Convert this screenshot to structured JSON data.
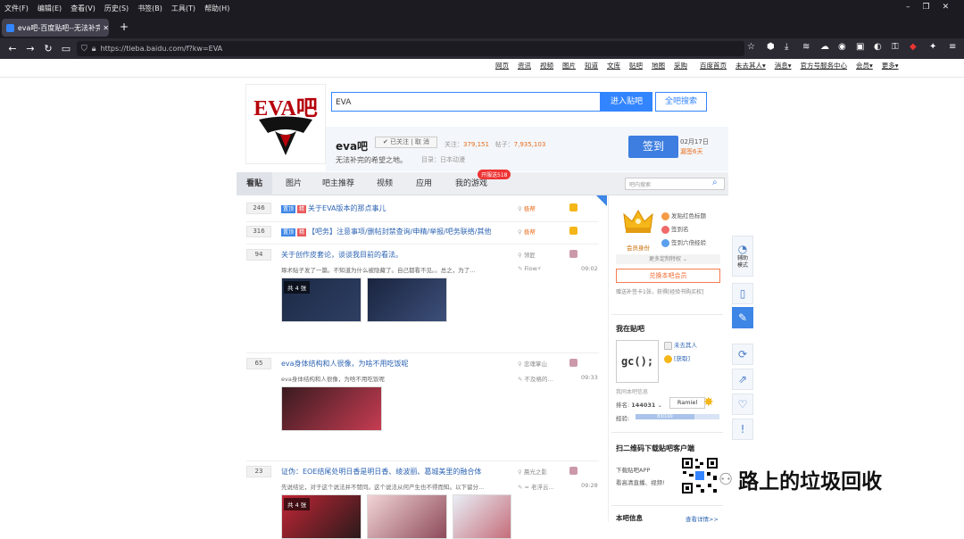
{
  "menubar": [
    "文件(F)",
    "编辑(E)",
    "查看(V)",
    "历史(S)",
    "书签(B)",
    "工具(T)",
    "帮助(H)"
  ],
  "window_controls": [
    "–",
    "❐",
    "✕"
  ],
  "tab": {
    "title": "eva吧-百度贴吧--无法补完",
    "close": "✕",
    "new": "+"
  },
  "url": "https://tieba.baidu.com/f?kw=EVA",
  "top_links": [
    "网页",
    "资讯",
    "视频",
    "图片",
    "知道",
    "文库",
    "贴吧",
    "地图",
    "采购",
    "百度首页",
    "未去其人▾",
    "消息▾",
    "官方号服务中心",
    "会员▾",
    "更多▾"
  ],
  "search": {
    "value": "EVA",
    "enter_label": "进入贴吧",
    "all_label": "全吧搜索"
  },
  "forum": {
    "name": "eva吧",
    "follow_label": "✔ 已关注 | 取 消",
    "followers_label": "关注：",
    "followers": "379,151",
    "posts_label": "帖子：",
    "posts": "7,935,103",
    "slogan": "无法补完的希望之地。",
    "dir_label": "目录：",
    "dir": "日本动漫",
    "sign_label": "签到",
    "sign_date": "02月17日",
    "sign_streak": "漏签6天"
  },
  "nav_tabs": [
    "看贴",
    "图片",
    "吧主推荐",
    "视频",
    "应用",
    "我的游戏"
  ],
  "badge": "开服送518",
  "bar_search_placeholder": "吧内搜索",
  "posts": [
    {
      "count": "246",
      "tags": [
        "置顶",
        "精"
      ],
      "title": "关于EVA版本的那点事儿",
      "author": "极帮",
      "time": ""
    },
    {
      "count": "316",
      "tags": [
        "置顶",
        "精"
      ],
      "title": "【吧务】注意事项/删帖封禁查询/申精/举报/吧务联络/其他",
      "author": "极帮",
      "time": ""
    },
    {
      "count": "94",
      "tags": [],
      "title": "关于创作皮套论，谈谈我目前的看法。",
      "desc": "琢术贴子发了一篇。不知道为什么被隐藏了。自己都看不见。。总之，为了...",
      "author": "领匠",
      "reply": "Fiow⚡",
      "time": "09:02",
      "images": true,
      "img_count": "共 4 张"
    },
    {
      "count": "65",
      "tags": [],
      "title": "eva身体结构和人很像，为啥不用吃饭呢",
      "desc": "eva身体结构和人很像，为啥不用吃饭呢",
      "author": "忠魂掌山",
      "reply": "不及格的...",
      "time": "09:33",
      "images": true
    },
    {
      "count": "23",
      "tags": [],
      "title": "证伪：EOE结尾处明日香是明日香、绫波丽、葛城美里的融合体",
      "desc": "先说结论，对于这个说法并不赞同。这个说法从何产生也不得而知。以下留分...",
      "author": "晨光之影",
      "reply": "= 老浮云...",
      "time": "09:28",
      "images": true,
      "img_count": "共 4 张"
    }
  ],
  "right": {
    "priv": [
      "发贴红色标题",
      "签到名",
      "签到六倍经验"
    ],
    "vip_label": "会员身份",
    "more_priv": "更多定制特权 ⌄",
    "redeem": "兑换本吧会员",
    "redeem_desc": "赠送补签卡1张，获得[经验书购买权]",
    "in_bar": "我在贴吧",
    "user": "未去其人",
    "coin": "[获取]",
    "avatar_text": "gc();",
    "level_title": "我同本吧信息",
    "rank_label": "排名:",
    "rank": "144031",
    "rank_title": "Ramiel",
    "exp_label": "经验:",
    "exp_value": "83/100",
    "exp_fraction": 0.7,
    "qr_title": "扫二维码下载贴吧客户端",
    "qr_desc1": "下载贴吧APP",
    "qr_desc2": "看高清直播、视频!",
    "info_title": "本吧信息",
    "info_link": "查看详情>>"
  },
  "sidebar": {
    "assist": "辅助\n模式"
  },
  "watermark": "路上的垃圾回收"
}
